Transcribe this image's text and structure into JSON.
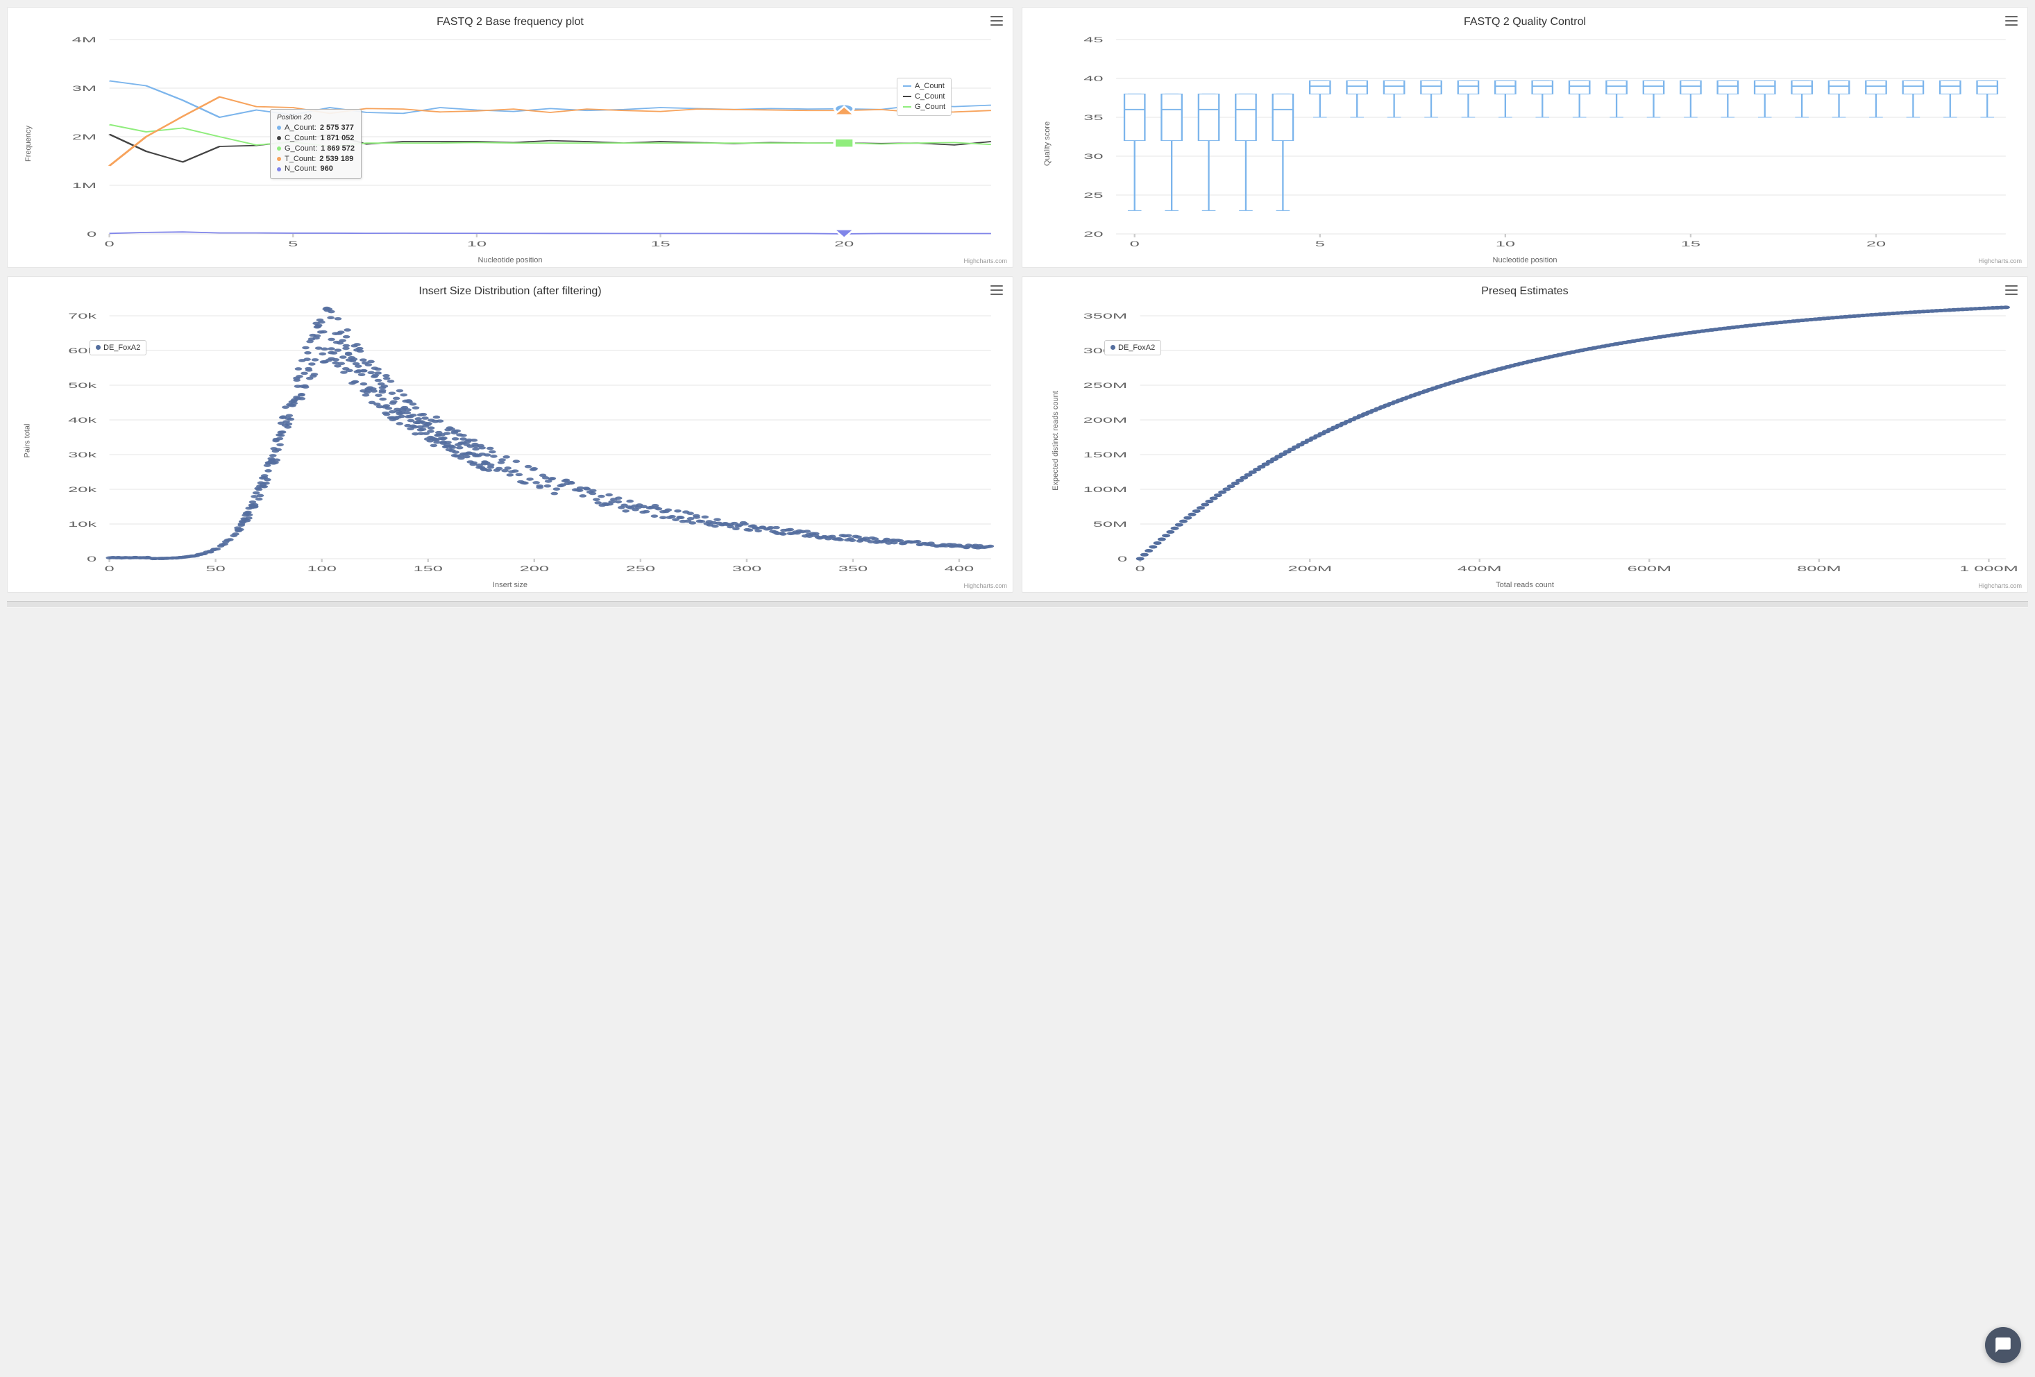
{
  "credit": "Highcharts.com",
  "chart_data": [
    {
      "id": "basefreq",
      "type": "line",
      "title": "FASTQ 2 Base frequency plot",
      "xlabel": "Nucleotide position",
      "ylabel": "Frequency",
      "x": [
        0,
        1,
        2,
        3,
        4,
        5,
        6,
        7,
        8,
        9,
        10,
        11,
        12,
        13,
        14,
        15,
        16,
        17,
        18,
        19,
        20,
        21,
        22,
        23,
        24
      ],
      "xticks": [
        0,
        5,
        10,
        15,
        20
      ],
      "yticks": [
        0,
        1000000,
        2000000,
        3000000,
        4000000
      ],
      "ytick_labels": [
        "0",
        "1M",
        "2M",
        "3M",
        "4M"
      ],
      "ylim": [
        0,
        4000000
      ],
      "legend_items": [
        "A_Count",
        "C_Count",
        "G_Count"
      ],
      "series": [
        {
          "name": "A_Count",
          "color": "#7cb5ec",
          "values": [
            3150000,
            3050000,
            2750000,
            2400000,
            2550000,
            2450000,
            2600000,
            2500000,
            2480000,
            2600000,
            2550000,
            2520000,
            2580000,
            2540000,
            2560000,
            2600000,
            2580000,
            2560000,
            2580000,
            2570000,
            2575377,
            2560000,
            2650000,
            2620000,
            2650000
          ]
        },
        {
          "name": "C_Count",
          "color": "#434343",
          "values": [
            2050000,
            1700000,
            1480000,
            1800000,
            1820000,
            1900000,
            2050000,
            1850000,
            1900000,
            1900000,
            1900000,
            1880000,
            1920000,
            1900000,
            1870000,
            1900000,
            1880000,
            1860000,
            1880000,
            1870000,
            1871052,
            1860000,
            1870000,
            1830000,
            1900000
          ]
        },
        {
          "name": "G_Count",
          "color": "#90ed7d",
          "values": [
            2250000,
            2100000,
            2180000,
            2000000,
            1830000,
            1890000,
            1800000,
            1870000,
            1870000,
            1870000,
            1880000,
            1870000,
            1870000,
            1870000,
            1870000,
            1870000,
            1870000,
            1870000,
            1870000,
            1870000,
            1869572,
            1850000,
            1870000,
            1880000,
            1840000
          ]
        },
        {
          "name": "T_Count",
          "color": "#f7a35c",
          "values": [
            1400000,
            2000000,
            2420000,
            2820000,
            2620000,
            2600000,
            2480000,
            2580000,
            2570000,
            2510000,
            2530000,
            2570000,
            2500000,
            2570000,
            2540000,
            2520000,
            2570000,
            2560000,
            2550000,
            2540000,
            2539189,
            2560000,
            2500000,
            2510000,
            2540000
          ]
        },
        {
          "name": "N_Count",
          "color": "#8085e9",
          "values": [
            10000,
            30000,
            40000,
            20000,
            20000,
            15000,
            15000,
            12000,
            14000,
            13000,
            12000,
            11000,
            10000,
            10000,
            9000,
            9000,
            8500,
            8500,
            8200,
            8000,
            960,
            8000,
            7800,
            7600,
            7500
          ]
        }
      ],
      "tooltip": {
        "title": "Position 20",
        "rows": [
          {
            "label": "A_Count",
            "value": "2 575 377",
            "color": "#7cb5ec"
          },
          {
            "label": "C_Count",
            "value": "1 871 052",
            "color": "#434343"
          },
          {
            "label": "G_Count",
            "value": "1 869 572",
            "color": "#90ed7d"
          },
          {
            "label": "T_Count",
            "value": "2 539 189",
            "color": "#f7a35c"
          },
          {
            "label": "N_Count",
            "value": "960",
            "color": "#8085e9"
          }
        ],
        "x_index": 20
      }
    },
    {
      "id": "qc",
      "type": "boxplot",
      "title": "FASTQ 2 Quality Control",
      "xlabel": "Nucleotide position",
      "ylabel": "Quality score",
      "xticks": [
        0,
        5,
        10,
        15,
        20
      ],
      "yticks": [
        20,
        25,
        30,
        35,
        40,
        45
      ],
      "ylim": [
        20,
        45
      ],
      "color": "#7cb5ec",
      "x": [
        0,
        1,
        2,
        3,
        4,
        5,
        6,
        7,
        8,
        9,
        10,
        11,
        12,
        13,
        14,
        15,
        16,
        17,
        18,
        19,
        20,
        21,
        22,
        23
      ],
      "boxes": [
        {
          "low": 23,
          "q1": 32,
          "median": 36,
          "q3": 38,
          "high": 38
        },
        {
          "low": 23,
          "q1": 32,
          "median": 36,
          "q3": 38,
          "high": 38
        },
        {
          "low": 23,
          "q1": 32,
          "median": 36,
          "q3": 38,
          "high": 38
        },
        {
          "low": 23,
          "q1": 32,
          "median": 36,
          "q3": 38,
          "high": 38
        },
        {
          "low": 23,
          "q1": 32,
          "median": 36,
          "q3": 38,
          "high": 38
        },
        {
          "low": 35,
          "q1": 38,
          "median": 39,
          "q3": 39.7,
          "high": 39.7
        },
        {
          "low": 35,
          "q1": 38,
          "median": 39,
          "q3": 39.7,
          "high": 39.7
        },
        {
          "low": 35,
          "q1": 38,
          "median": 39,
          "q3": 39.7,
          "high": 39.7
        },
        {
          "low": 35,
          "q1": 38,
          "median": 39,
          "q3": 39.7,
          "high": 39.7
        },
        {
          "low": 35,
          "q1": 38,
          "median": 39,
          "q3": 39.7,
          "high": 39.7
        },
        {
          "low": 35,
          "q1": 38,
          "median": 39,
          "q3": 39.7,
          "high": 39.7
        },
        {
          "low": 35,
          "q1": 38,
          "median": 39,
          "q3": 39.7,
          "high": 39.7
        },
        {
          "low": 35,
          "q1": 38,
          "median": 39,
          "q3": 39.7,
          "high": 39.7
        },
        {
          "low": 35,
          "q1": 38,
          "median": 39,
          "q3": 39.7,
          "high": 39.7
        },
        {
          "low": 35,
          "q1": 38,
          "median": 39,
          "q3": 39.7,
          "high": 39.7
        },
        {
          "low": 35,
          "q1": 38,
          "median": 39,
          "q3": 39.7,
          "high": 39.7
        },
        {
          "low": 35,
          "q1": 38,
          "median": 39,
          "q3": 39.7,
          "high": 39.7
        },
        {
          "low": 35,
          "q1": 38,
          "median": 39,
          "q3": 39.7,
          "high": 39.7
        },
        {
          "low": 35,
          "q1": 38,
          "median": 39,
          "q3": 39.7,
          "high": 39.7
        },
        {
          "low": 35,
          "q1": 38,
          "median": 39,
          "q3": 39.7,
          "high": 39.7
        },
        {
          "low": 35,
          "q1": 38,
          "median": 39,
          "q3": 39.7,
          "high": 39.7
        },
        {
          "low": 35,
          "q1": 38,
          "median": 39,
          "q3": 39.7,
          "high": 39.7
        },
        {
          "low": 35,
          "q1": 38,
          "median": 39,
          "q3": 39.7,
          "high": 39.7
        },
        {
          "low": 35,
          "q1": 38,
          "median": 39,
          "q3": 39.7,
          "high": 39.7
        }
      ]
    },
    {
      "id": "insert",
      "type": "scatter",
      "title": "Insert Size Distribution (after filtering)",
      "xlabel": "Insert size",
      "ylabel": "Pairs total",
      "legend": "DE_FoxA2",
      "xticks": [
        0,
        50,
        100,
        150,
        200,
        250,
        300,
        350,
        400
      ],
      "yticks": [
        0,
        10000,
        20000,
        30000,
        40000,
        50000,
        60000,
        70000
      ],
      "ytick_labels": [
        "0",
        "10k",
        "20k",
        "30k",
        "40k",
        "50k",
        "60k",
        "70k"
      ],
      "xlim": [
        0,
        415
      ],
      "ylim": [
        0,
        70000
      ],
      "color": "#546e9e",
      "peak_x": 105,
      "peak_y": 65000,
      "sigma_left": 22,
      "sigma_right": 60
    },
    {
      "id": "preseq",
      "type": "scatter",
      "title": "Preseq Estimates",
      "xlabel": "Total reads count",
      "ylabel": "Expected distinct reads count",
      "legend": "DE_FoxA2",
      "xticks": [
        0,
        200000000,
        400000000,
        600000000,
        800000000,
        1000000000
      ],
      "xtick_labels": [
        "0",
        "200M",
        "400M",
        "600M",
        "800M",
        "1 000M"
      ],
      "yticks": [
        0,
        50000000,
        100000000,
        150000000,
        200000000,
        250000000,
        300000000,
        350000000
      ],
      "ytick_labels": [
        "0",
        "50M",
        "100M",
        "150M",
        "200M",
        "250M",
        "300M",
        "350M"
      ],
      "xlim": [
        0,
        1020000000
      ],
      "ylim": [
        0,
        350000000
      ],
      "color": "#546e9e",
      "asymptote": 380000000
    }
  ]
}
